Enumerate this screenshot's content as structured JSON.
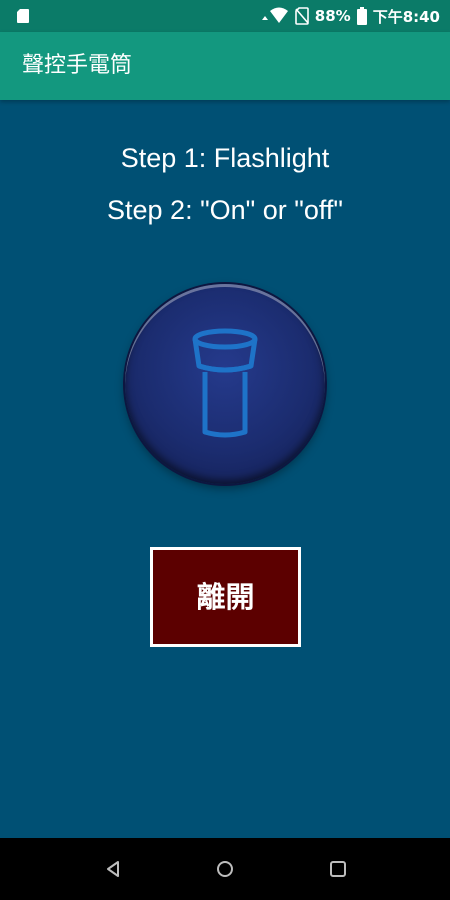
{
  "status_bar": {
    "battery_percent": "88%",
    "time": "下午8:40",
    "icons": [
      "sd-card-icon",
      "wifi-icon",
      "no-sim-icon",
      "battery-icon"
    ]
  },
  "app_bar": {
    "title": "聲控手電筒"
  },
  "main": {
    "step1": "Step 1:  Flashlight",
    "step2": "Step 2: \"On\" or \"off\"",
    "flashlight_button": {
      "icon": "flashlight-icon"
    },
    "exit_button_label": "離開"
  },
  "nav_bar": {
    "icons": [
      "back-icon",
      "home-icon",
      "recent-apps-icon"
    ]
  },
  "colors": {
    "status_bar": "#0b7b68",
    "app_bar": "#13987f",
    "background": "#005074",
    "flash_button": "#1b2c6f",
    "flash_icon": "#1e73c8",
    "exit_button": "#5c0000",
    "nav_bar": "#000000"
  }
}
